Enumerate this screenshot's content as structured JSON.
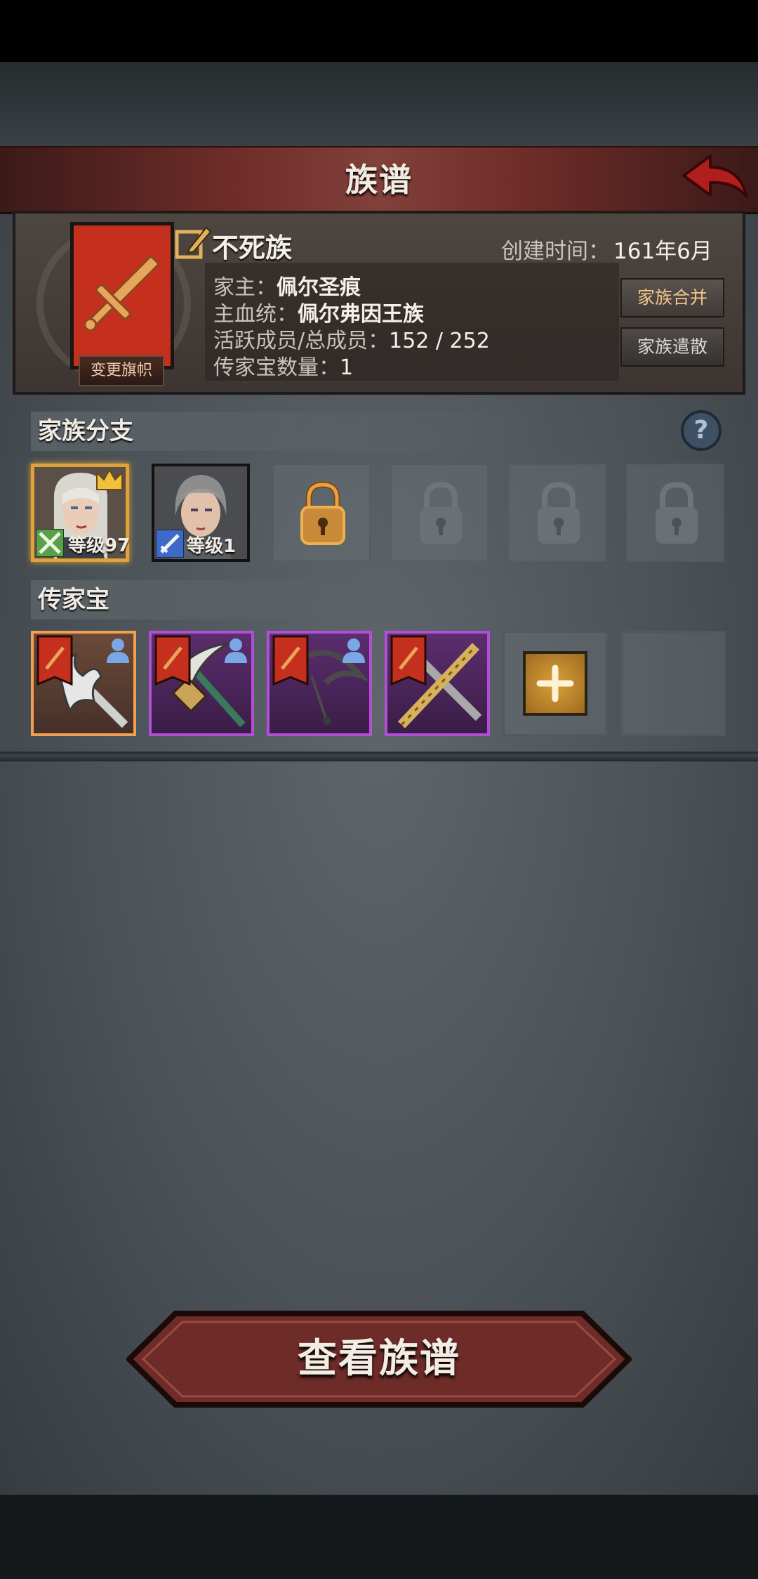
{
  "header": {
    "title": "族谱"
  },
  "family": {
    "name": "不死族",
    "created_label": "创建时间：",
    "created_value": "161年6月",
    "head_label": "家主：",
    "head_value": "佩尔圣痕",
    "bloodline_label": "主血统：",
    "bloodline_value": "佩尔弗因王族",
    "members_label": "活跃成员/总成员：",
    "members_value": "152 / 252",
    "heirloom_count_label": "传家宝数量：",
    "heirloom_count_value": "1",
    "change_banner_label": "变更旗帜",
    "merge_label": "家族合并",
    "disband_label": "家族遣散",
    "banner_color": "#c5301e"
  },
  "branches": {
    "title": "家族分支",
    "help_icon": "?",
    "members": [
      {
        "level": "等级97",
        "frame_color": "#e0a23a",
        "is_head": true,
        "class_icon": "crossed-swords-icon"
      },
      {
        "level": "等级1",
        "frame_color": "#121212",
        "is_head": false,
        "class_icon": "sword-icon"
      }
    ],
    "locked_slots": 4
  },
  "heirlooms": {
    "title": "传家宝",
    "items": [
      {
        "weapon": "halberd",
        "rarity": "orange",
        "rarity_color": "#f0a050"
      },
      {
        "weapon": "pickaxe",
        "rarity": "purple",
        "rarity_color": "#b34fd6"
      },
      {
        "weapon": "bow",
        "rarity": "purple",
        "rarity_color": "#b34fd6"
      },
      {
        "weapon": "crossed-swords",
        "rarity": "purple",
        "rarity_color": "#b34fd6"
      }
    ],
    "add_symbol": "+"
  },
  "footer": {
    "view_tree_label": "查看族谱"
  }
}
